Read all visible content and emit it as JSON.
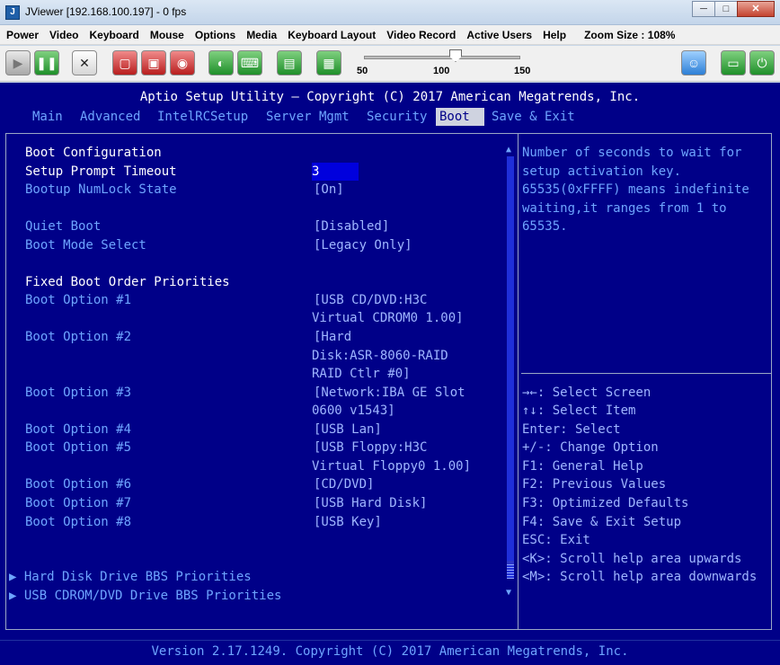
{
  "window": {
    "title": "JViewer [192.168.100.197] - 0 fps",
    "minimize": "─",
    "maximize": "□",
    "close": "✕"
  },
  "menu": {
    "items": [
      "Power",
      "Video",
      "Keyboard",
      "Mouse",
      "Options",
      "Media",
      "Keyboard Layout",
      "Video Record",
      "Active Users",
      "Help"
    ],
    "zoom_label": "Zoom Size : 108%"
  },
  "toolbar": {
    "slider_ticks": [
      "50",
      "100",
      "150"
    ],
    "zoom_value": 108
  },
  "bios": {
    "header": "Aptio Setup Utility – Copyright (C) 2017 American Megatrends, Inc.",
    "tabs": [
      "Main",
      "Advanced",
      "IntelRCSetup",
      "Server Mgmt",
      "Security",
      "Boot",
      "Save & Exit"
    ],
    "active_tab": "Boot",
    "section_title": "Boot Configuration",
    "settings": [
      {
        "label": "Setup Prompt Timeout",
        "value": "3"
      },
      {
        "label": "Bootup NumLock State",
        "value": "[On]"
      },
      {
        "label": "Quiet Boot",
        "value": "[Disabled]"
      },
      {
        "label": "Boot Mode Select",
        "value": "[Legacy Only]"
      }
    ],
    "fixed_title": "Fixed Boot Order Priorities",
    "boot_options": [
      {
        "label": "Boot Option #1",
        "value": [
          "[USB CD/DVD:H3C",
          "Virtual CDROM0 1.00]"
        ]
      },
      {
        "label": "Boot Option #2",
        "value": [
          "[Hard",
          "Disk:ASR-8060-RAID",
          "RAID Ctlr #0]"
        ]
      },
      {
        "label": "Boot Option #3",
        "value": [
          "[Network:IBA GE Slot",
          "0600 v1543]"
        ]
      },
      {
        "label": "Boot Option #4",
        "value": [
          "[USB Lan]"
        ]
      },
      {
        "label": "Boot Option #5",
        "value": [
          "[USB Floppy:H3C",
          "Virtual Floppy0 1.00]"
        ]
      },
      {
        "label": "Boot Option #6",
        "value": [
          "[CD/DVD]"
        ]
      },
      {
        "label": "Boot Option #7",
        "value": [
          "[USB Hard Disk]"
        ]
      },
      {
        "label": "Boot Option #8",
        "value": [
          "[USB Key]"
        ]
      }
    ],
    "submenus": [
      "Hard Disk Drive BBS Priorities",
      "USB CDROM/DVD Drive BBS Priorities"
    ],
    "help_text": [
      "Number of seconds to wait for",
      "setup activation key.",
      "65535(0xFFFF) means indefinite",
      "waiting,it ranges from 1 to",
      "65535."
    ],
    "key_help": [
      "→←: Select Screen",
      "↑↓: Select Item",
      "Enter: Select",
      "+/-: Change Option",
      "F1: General Help",
      "F2: Previous Values",
      "F3: Optimized Defaults",
      "F4: Save & Exit Setup",
      "ESC: Exit",
      "<K>: Scroll help area upwards",
      "<M>: Scroll help area downwards"
    ],
    "footer": "Version 2.17.1249. Copyright (C) 2017 American Megatrends, Inc."
  }
}
